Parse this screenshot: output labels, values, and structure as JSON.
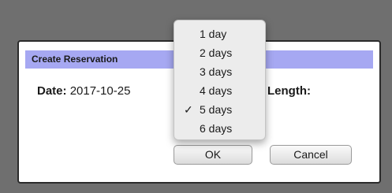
{
  "dialog": {
    "title": "Create Reservation",
    "date_label": "Date:",
    "date_value": "2017-10-25",
    "length_label": "Length:",
    "ok_label": "OK",
    "cancel_label": "Cancel"
  },
  "length_dropdown": {
    "selected_index": 4,
    "check_mark": "✓",
    "options": [
      "1 day",
      "2 days",
      "3 days",
      "4 days",
      "5 days",
      "6 days"
    ]
  }
}
